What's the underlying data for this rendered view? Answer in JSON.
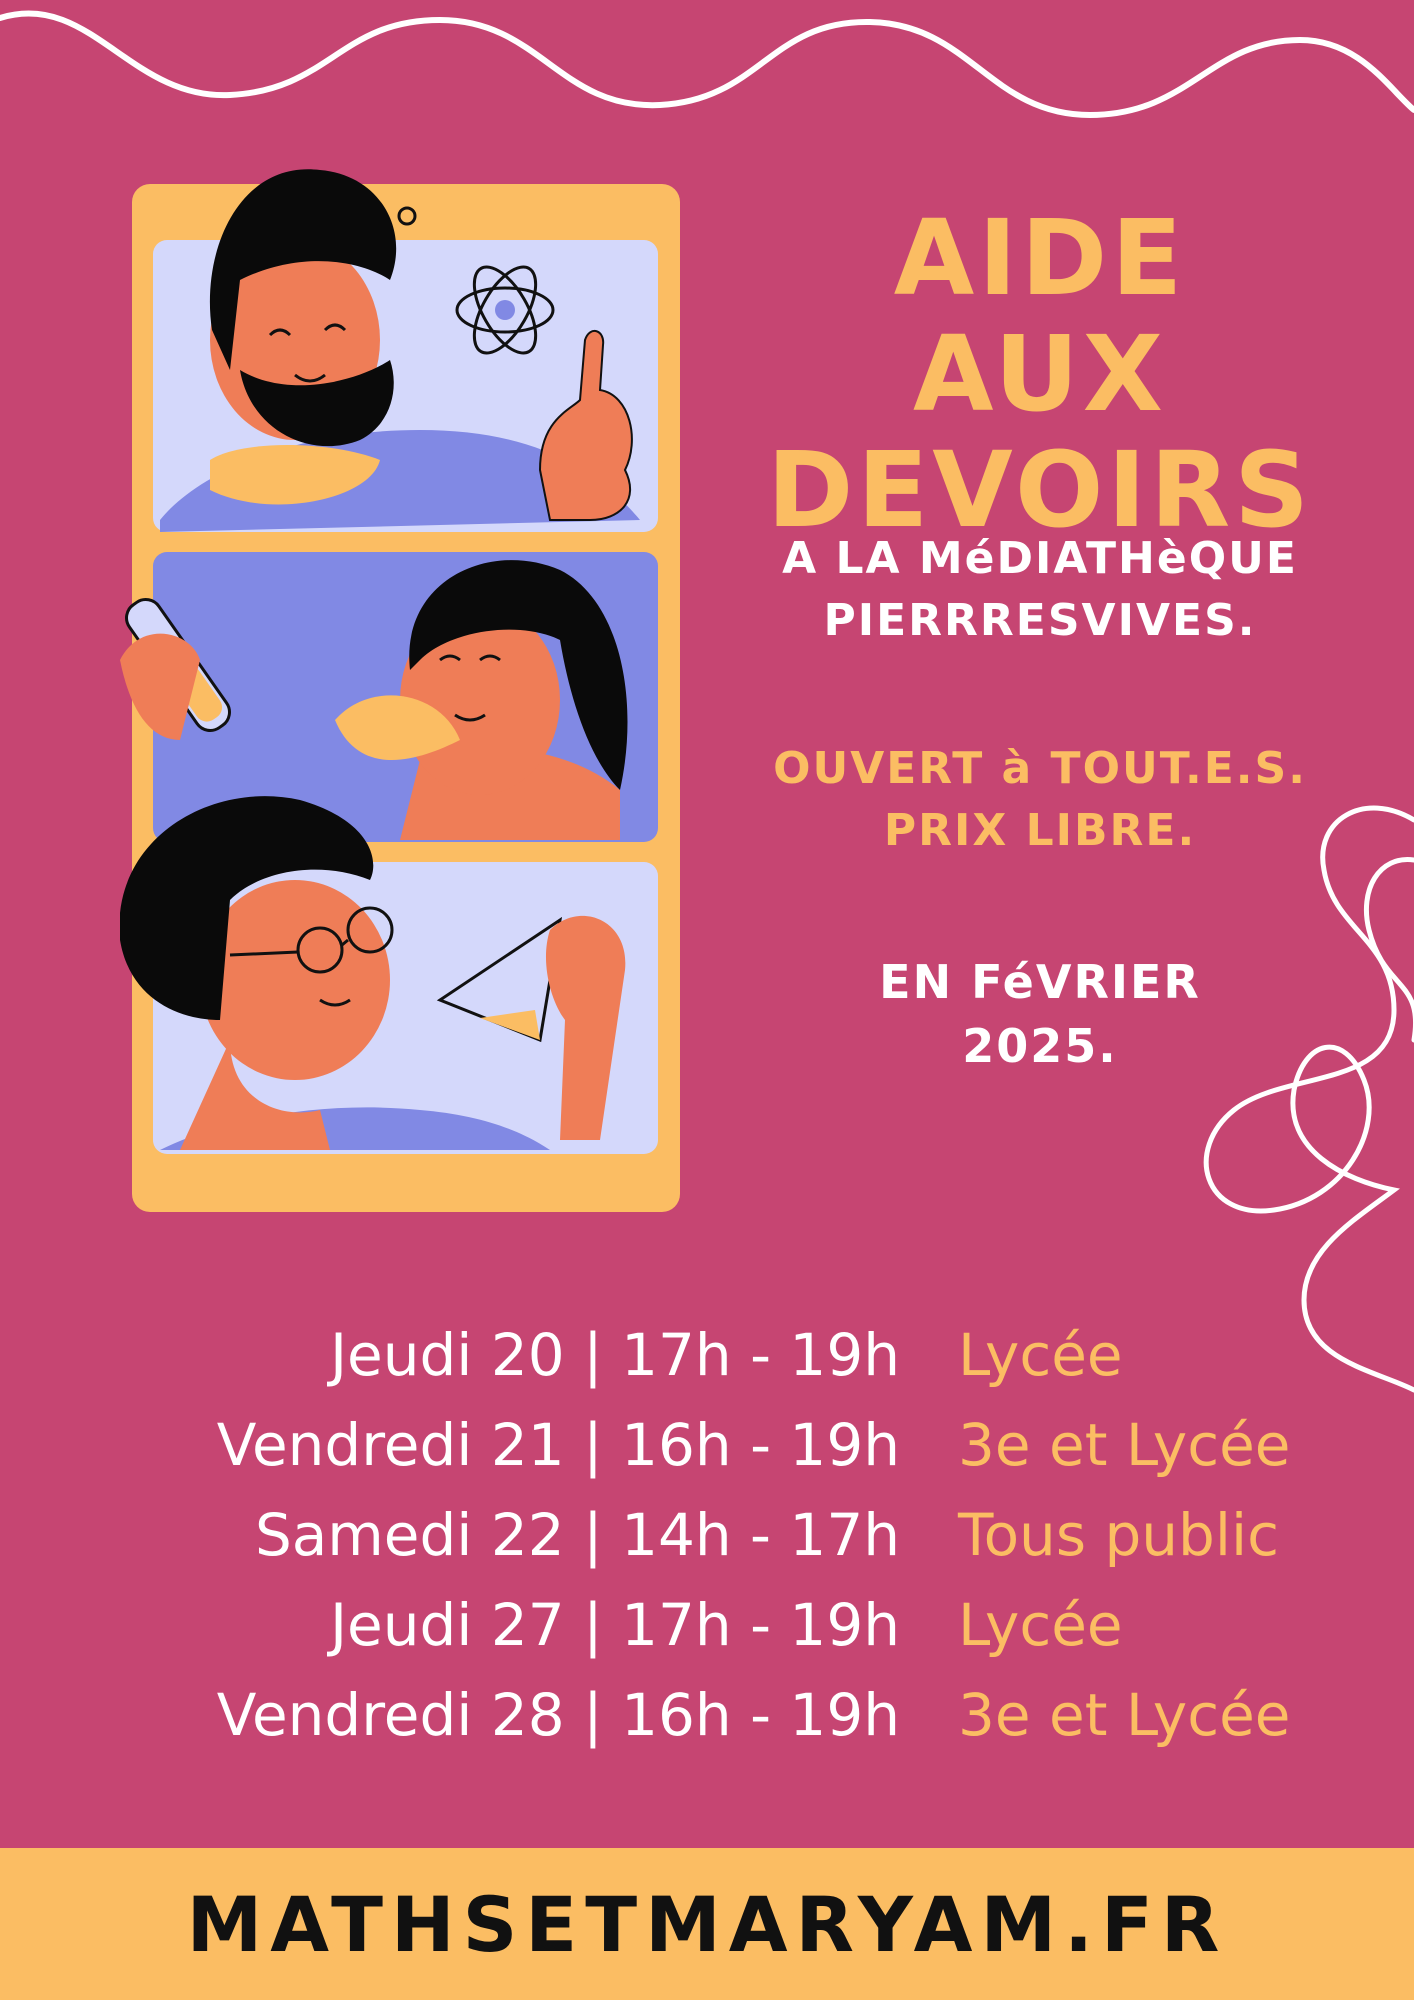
{
  "colors": {
    "background": "#c64572",
    "accent_yellow": "#fbbd63",
    "text_white": "#ffffff",
    "footer_text": "#111111",
    "phone_frame": "#fbbd63",
    "panel_light": "#d4d8fb",
    "panel_blue": "#8189e4",
    "skin": "#ef7d57",
    "hair": "#0a0a0a"
  },
  "title": {
    "line1": "AIDE AUX",
    "line2": "DEVOIRS"
  },
  "location": {
    "line1": "A LA MéDIATHèQUE",
    "line2": "PIERRRESVIVES."
  },
  "access": {
    "line1": "OUVERT à TOUT.E.S.",
    "line2": "PRIX LIBRE."
  },
  "period": {
    "line1": "EN FéVRIER",
    "line2": "2025."
  },
  "schedule": [
    {
      "when": "Jeudi 20 | 17h - 19h",
      "who": "Lycée"
    },
    {
      "when": "Vendredi 21 | 16h - 19h",
      "who": "3e et Lycée"
    },
    {
      "when": "Samedi 22 | 14h - 17h",
      "who": "Tous public"
    },
    {
      "when": "Jeudi 27 | 17h - 19h",
      "who": "Lycée"
    },
    {
      "when": "Vendredi 28 | 16h - 19h",
      "who": "3e et Lycée"
    }
  ],
  "footer": {
    "website": "MATHSETMARYAM.FR"
  },
  "illustration": {
    "icons": [
      "atom-icon",
      "test-tube-icon",
      "flask-icon",
      "glasses-icon",
      "thumbs-up-icon"
    ]
  }
}
